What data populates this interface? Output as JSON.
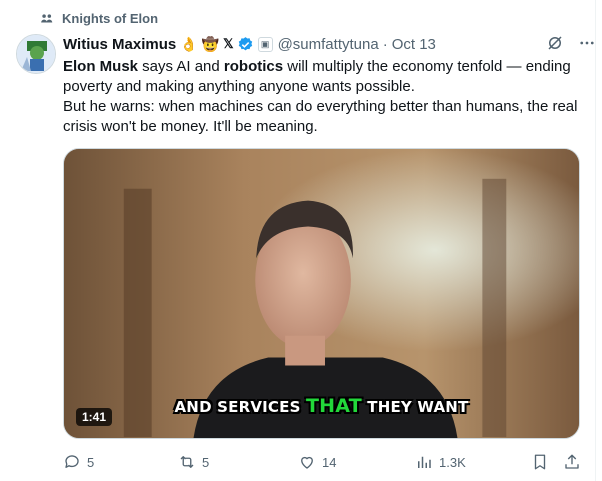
{
  "community": {
    "name": "Knights of Elon",
    "icon": "community-icon"
  },
  "author": {
    "name": "Witius Maximus",
    "emojis": [
      "👌",
      "🤠"
    ],
    "x_badge": "𝕏",
    "handle": "@sumfattytuna",
    "separator": "·",
    "time": "Oct 13",
    "verified_color": "#1d9bf0"
  },
  "post": {
    "p1_bold1": "Elon Musk",
    "p1_t1": " says AI and ",
    "p1_bold2": "robotics",
    "p1_t2": " will multiply the economy tenfold — ending poverty and making anything anyone wants possible.",
    "p2": "But he warns: when machines can do everything better than humans, the real crisis won't be money. It'll be meaning."
  },
  "media": {
    "caption_before": "AND SERVICES ",
    "caption_highlight": "THAT",
    "caption_after": " THEY WANT",
    "duration": "1:41",
    "highlight_color": "#22d83a"
  },
  "actions": {
    "replies": "5",
    "reposts": "5",
    "likes": "14",
    "views": "1.3K"
  },
  "icons": {
    "grok": "grok-icon",
    "more": "more-icon",
    "reply": "reply-icon",
    "repost": "repost-icon",
    "like": "like-icon",
    "views": "views-icon",
    "bookmark": "bookmark-icon",
    "share": "share-icon"
  }
}
